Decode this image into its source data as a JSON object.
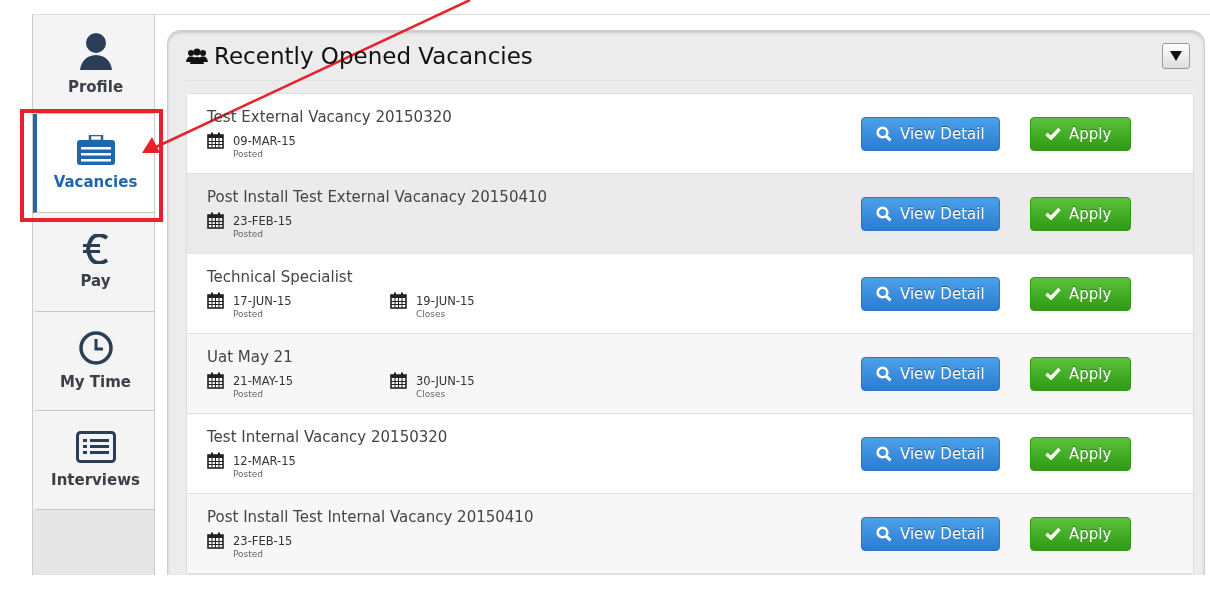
{
  "sidebar": {
    "items": [
      {
        "label": "Profile",
        "kind": "person",
        "selected": false
      },
      {
        "label": "Vacancies",
        "kind": "briefcase",
        "selected": true
      },
      {
        "label": "Pay",
        "kind": "euro",
        "selected": false
      },
      {
        "label": "My Time",
        "kind": "clock",
        "selected": false
      },
      {
        "label": "Interviews",
        "kind": "list",
        "selected": false
      }
    ]
  },
  "panel": {
    "title": "Recently Opened Vacancies",
    "expanded": true,
    "vacancies": [
      {
        "title": "Test External Vacancy 20150320",
        "hovered": false,
        "dates": [
          {
            "date": "09-MAR-15",
            "label": "Posted"
          }
        ],
        "buttons": [
          "View Detail",
          "Apply"
        ]
      },
      {
        "title": "Post Install Test External Vacanacy 20150410",
        "hovered": true,
        "dates": [
          {
            "date": "23-FEB-15",
            "label": "Posted"
          }
        ],
        "buttons": [
          "View Detail",
          "Apply"
        ]
      },
      {
        "title": "Technical Specialist",
        "hovered": false,
        "dates": [
          {
            "date": "17-JUN-15",
            "label": "Posted"
          },
          {
            "date": "19-JUN-15",
            "label": "Closes"
          }
        ],
        "buttons": [
          "View Detail",
          "Apply"
        ]
      },
      {
        "title": "Uat May 21",
        "hovered": false,
        "dates": [
          {
            "date": "21-MAY-15",
            "label": "Posted"
          },
          {
            "date": "30-JUN-15",
            "label": "Closes"
          }
        ],
        "buttons": [
          "View Detail",
          "Apply"
        ]
      },
      {
        "title": "Test Internal Vacancy 20150320",
        "hovered": false,
        "dates": [
          {
            "date": "12-MAR-15",
            "label": "Posted"
          }
        ],
        "buttons": [
          "View Detail",
          "Apply"
        ]
      },
      {
        "title": "Post Install Test Internal Vacancy 20150410",
        "hovered": false,
        "dates": [
          {
            "date": "23-FEB-15",
            "label": "Posted"
          }
        ],
        "buttons": [
          "View Detail",
          "Apply"
        ]
      }
    ]
  }
}
